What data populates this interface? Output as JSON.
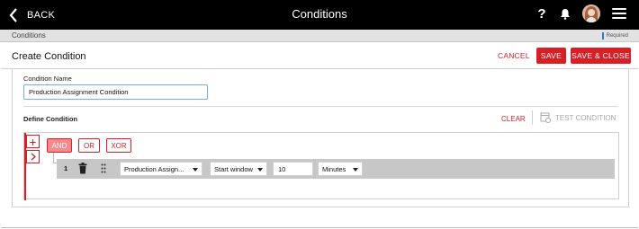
{
  "header": {
    "back_label": "BACK",
    "title": "Conditions",
    "help_glyph": "?",
    "icons": [
      "back-chevron-icon",
      "help-icon",
      "bell-icon",
      "avatar",
      "hamburger-menu-icon"
    ]
  },
  "breadcrumb": {
    "current": "Conditions",
    "required_label": "Required"
  },
  "panel": {
    "title": "Create Condition",
    "cancel_label": "CANCEL",
    "save_label": "SAVE",
    "save_close_label": "SAVE & CLOSE"
  },
  "form": {
    "condition_name_label": "Condition Name",
    "condition_name_value": "Production Assignment Condition"
  },
  "define": {
    "label": "Define Condition",
    "clear_label": "CLEAR",
    "test_label": "TEST CONDITION",
    "add_glyph": "+",
    "operators": [
      {
        "label": "AND",
        "selected": true
      },
      {
        "label": "OR",
        "selected": false
      },
      {
        "label": "XOR",
        "selected": false
      }
    ],
    "rules": [
      {
        "number": "1",
        "field": "Production Assign...",
        "operator": "Start window",
        "value": "10",
        "unit": "Minutes"
      }
    ]
  },
  "colors": {
    "accent": "#d71f26",
    "and_selected": "#f38b8f",
    "topbar": "#000000",
    "focus": "#6fb0e8"
  }
}
